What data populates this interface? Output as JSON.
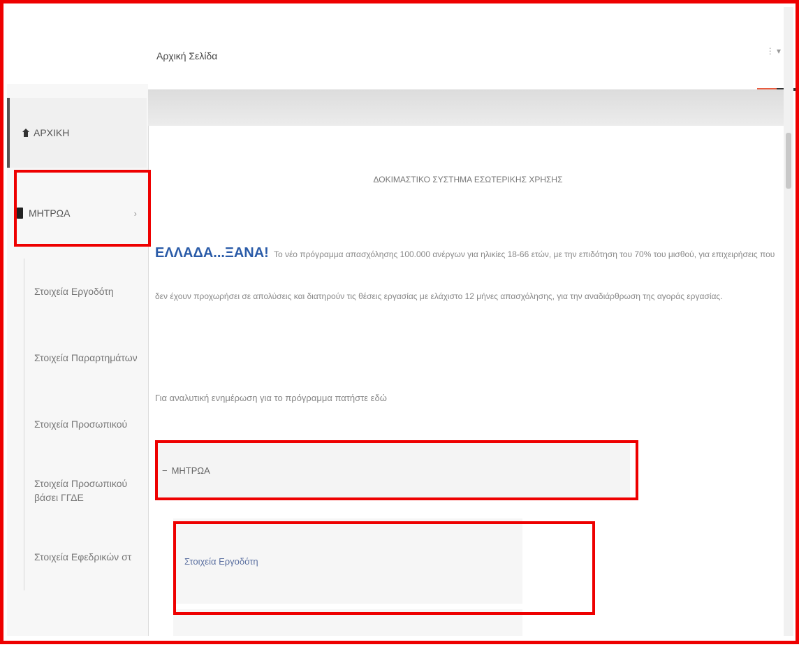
{
  "header": {
    "title": "Αρχική Σελίδα",
    "user_glyph": "⋮",
    "dropdown_glyph": "▾"
  },
  "sidebar": {
    "home_label": "ΑΡΧΙΚΗ",
    "registers_label": "ΜΗΤΡΩΑ",
    "registers_chevron": "›",
    "submenu": [
      {
        "label": "Στοιχεία Εργοδότη"
      },
      {
        "label": "Στοιχεία Παραρτημάτων"
      },
      {
        "label": "Στοιχεία Προσωπικού"
      },
      {
        "label": "Στοιχεία Προσωπικού βάσει ΓΓΔΕ"
      },
      {
        "label": "Στοιχεία Εφεδρικών στ"
      }
    ]
  },
  "content": {
    "banner": "ΔΟΚΙΜΑΣΤΙΚΟ ΣΥΣΤΗΜΑ ΕΣΩΤΕΡΙΚΗΣ ΧΡΗΣΗΣ",
    "brand": "ΕΛΛΑΔΑ...ΞΑΝΑ!",
    "intro_text": "Το νέο πρόγραμμα απασχόλησης 100.000 ανέργων για ηλικίες 18-66 ετών, με την επιδότηση του 70% του μισθού, για επιχειρήσεις που δεν έχουν προχωρήσει σε απολύσεις και διατηρούν τις θέσεις εργασίας με ελάχιστο 12 μήνες απασχόλησης, για την αναδιάρθρωση της αγοράς εργασίας.",
    "info_line": "Για αναλυτική ενημέρωση για το πρόγραμμα πατήστε εδώ",
    "accordion_header": "ΜΗΤΡΩΑ",
    "accordion_toggle": "−",
    "accordion_sub": "Στοιχεία Εργοδότη"
  },
  "colors": {
    "annotation": "#ee0000",
    "brand": "#2a5ba8",
    "flag_orange": "#e85c3f",
    "flag_dark": "#333333"
  },
  "icons": [
    "home-icon",
    "book-icon",
    "chevron-right-icon",
    "user-icon",
    "chevron-down-icon"
  ]
}
